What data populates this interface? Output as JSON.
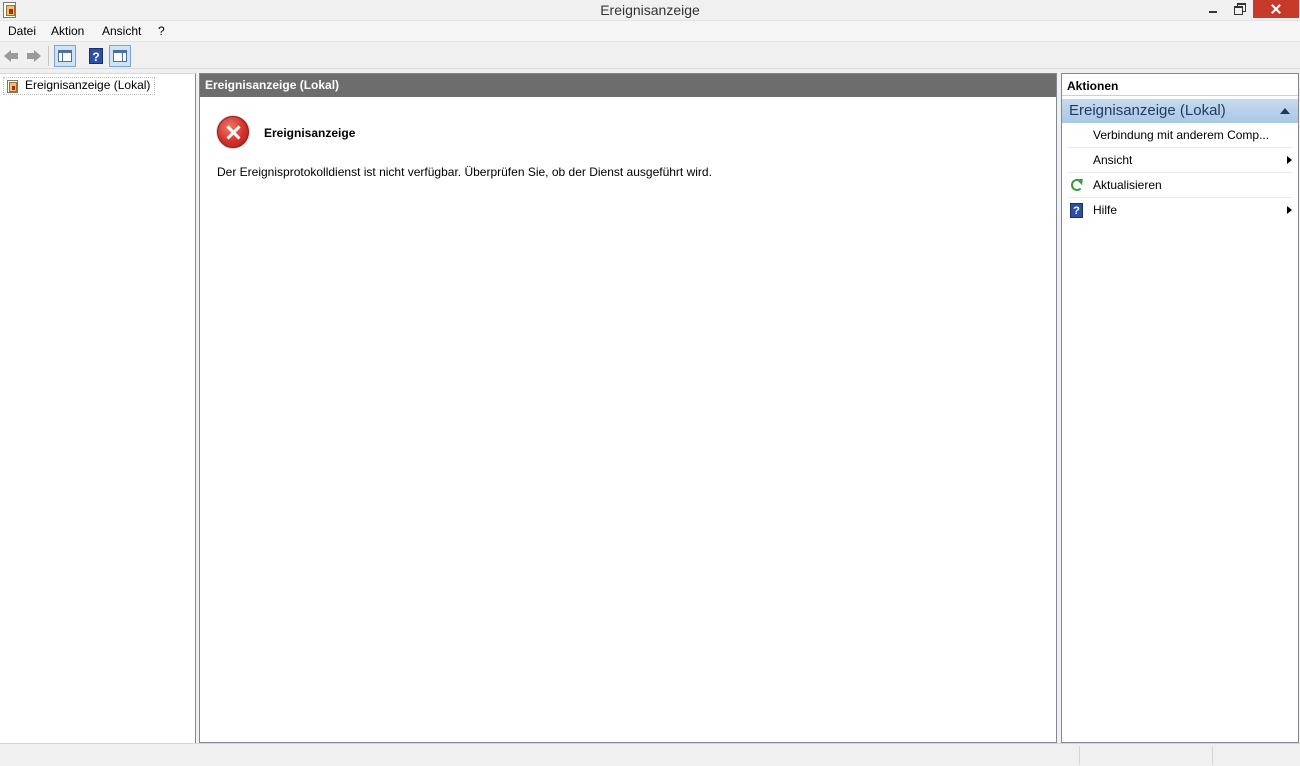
{
  "window": {
    "title": "Ereignisanzeige"
  },
  "menu": {
    "items": [
      "Datei",
      "Aktion",
      "Ansicht",
      "?"
    ]
  },
  "toolbar": {
    "help_glyph": "?"
  },
  "tree": {
    "root_label": "Ereignisanzeige (Lokal)"
  },
  "center": {
    "header": "Ereignisanzeige (Lokal)",
    "error_title": "Ereignisanzeige",
    "error_message": "Der Ereignisprotokolldienst ist nicht verfügbar. Überprüfen Sie, ob der Dienst ausgeführt wird."
  },
  "actions": {
    "title": "Aktionen",
    "section_title": "Ereignisanzeige (Lokal)",
    "items": [
      {
        "label": "Verbindung mit anderem Comp...",
        "icon": "none",
        "has_submenu": false
      },
      {
        "label": "Ansicht",
        "icon": "none",
        "has_submenu": true
      },
      {
        "label": "Aktualisieren",
        "icon": "refresh-icon",
        "has_submenu": false
      },
      {
        "label": "Hilfe",
        "icon": "help-icon",
        "has_submenu": true
      }
    ],
    "help_glyph": "?"
  },
  "colors": {
    "header_gray": "#6d6d6d",
    "section_blue": "#a9c7e6",
    "close_red": "#c7392b",
    "error_red": "#d1312a"
  }
}
